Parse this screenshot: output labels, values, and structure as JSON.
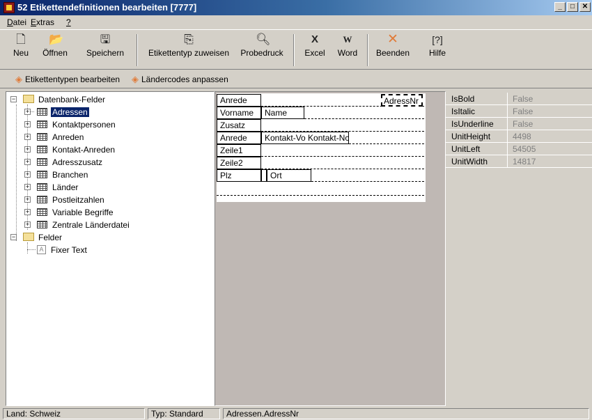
{
  "window": {
    "title": "52 Etikettendefinitionen bearbeiten [7777]",
    "buttons": [
      "_",
      "□",
      "✕"
    ]
  },
  "menu": [
    {
      "label": "Datei",
      "u": "D",
      "rest": "atei"
    },
    {
      "label": "Extras",
      "u": "E",
      "rest": "xtras"
    },
    {
      "label": "?",
      "u": "?",
      "rest": ""
    }
  ],
  "toolbar": {
    "new": "Neu",
    "open": "Öffnen",
    "save": "Speichern",
    "assign": "Etikettentyp zuweisen",
    "preview": "Probedruck",
    "excel": "Excel",
    "word": "Word",
    "quit": "Beenden",
    "help": "Hilfe",
    "icons": {
      "new": "new-document-icon",
      "open": "open-folder-icon",
      "save": "floppy-disk-icon",
      "assign": "assign-label-icon",
      "preview": "print-preview-icon",
      "excel": "excel-icon",
      "word": "word-icon",
      "quit": "close-icon",
      "help": "help-icon"
    }
  },
  "toolbar2": {
    "edit_types": "Etikettentypen bearbeiten",
    "country_codes": "Ländercodes anpassen"
  },
  "tree": {
    "root1": "Datenbank-Felder",
    "tables": [
      "Adressen",
      "Kontaktpersonen",
      "Anreden",
      "Kontakt-Anreden",
      "Adresszusatz",
      "Branchen",
      "Länder",
      "Postleitzahlen",
      "Variable Begriffe",
      "Zentrale Länderdatei"
    ],
    "root2": "Felder",
    "fixed": "Fixer Text",
    "selected": "Adressen"
  },
  "canvas": {
    "anrede": "Anrede",
    "adressnr": "AdressNr",
    "vorname": "Vorname",
    "name": "Name",
    "zusatz": "Zusatz",
    "anrede2": "Anrede",
    "kontakt": "Kontakt-Vo Kontakt-Nc",
    "zeile1": "Zeile1",
    "zeile2": "Zeile2",
    "plz": "Plz",
    "ort": "Ort"
  },
  "properties": [
    {
      "name": "IsBold",
      "value": "False"
    },
    {
      "name": "IsItalic",
      "value": "False"
    },
    {
      "name": "IsUnderline",
      "value": "False"
    },
    {
      "name": "UnitHeight",
      "value": "4498"
    },
    {
      "name": "UnitLeft",
      "value": "54505"
    },
    {
      "name": "UnitWidth",
      "value": "14817"
    }
  ],
  "status": {
    "country": "Land: Schweiz",
    "type": "Typ: Standard",
    "field": "Adressen.AdressNr"
  },
  "colors": {
    "title_start": "#0a246a",
    "title_end": "#a6caf0",
    "selection": "#0a246a",
    "design_bg": "#bfb8b4",
    "accent": "#e07b39"
  }
}
